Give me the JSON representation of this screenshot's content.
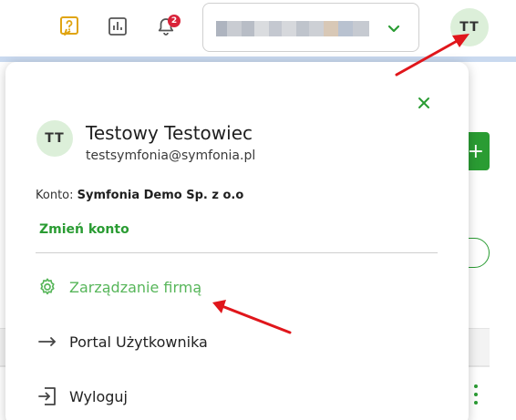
{
  "header": {
    "help_icon": "help-question-icon",
    "reports_icon": "reports-chart-icon",
    "notifications_icon": "bell-icon",
    "notification_count": "2",
    "company_selector_value": "",
    "user_initials": "TT"
  },
  "user_menu": {
    "initials": "TT",
    "name": "Testowy Testowiec",
    "email": "testsymfonia@symfonia.pl",
    "account_label": "Konto: ",
    "account_name": "Symfonia Demo Sp. z o.o",
    "switch_account": "Zmień konto",
    "items": [
      {
        "label": "Zarządzanie firmą",
        "icon": "gear-icon",
        "highlighted": true
      },
      {
        "label": "Portal Użytkownika",
        "icon": "arrow-right-icon",
        "highlighted": false
      },
      {
        "label": "Wyloguj",
        "icon": "logout-icon",
        "highlighted": false
      }
    ]
  },
  "background": {
    "add_button_glyph": "+"
  },
  "colors": {
    "brand_green": "#2a9c33",
    "highlight_green": "#57b65a",
    "avatar_bg": "#dcefd9",
    "badge_red": "#d9233a",
    "annotation_red": "#e0161b"
  }
}
